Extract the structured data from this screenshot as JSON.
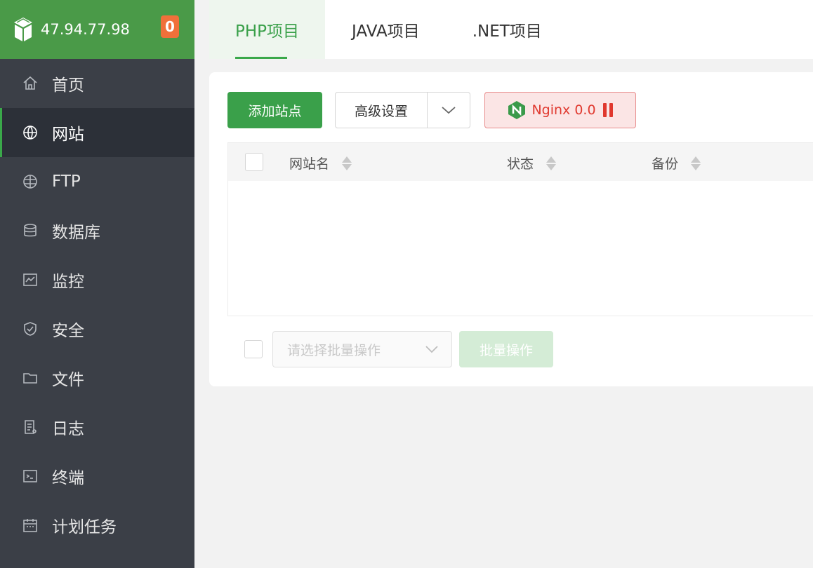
{
  "header": {
    "ip": "47.94.77.98",
    "badge": "0"
  },
  "sidebar": {
    "items": [
      {
        "label": "首页",
        "icon": "home-icon"
      },
      {
        "label": "网站",
        "icon": "globe-icon",
        "active": true
      },
      {
        "label": "FTP",
        "icon": "ftp-globe-icon"
      },
      {
        "label": "数据库",
        "icon": "database-icon"
      },
      {
        "label": "监控",
        "icon": "monitor-icon"
      },
      {
        "label": "安全",
        "icon": "shield-icon"
      },
      {
        "label": "文件",
        "icon": "folder-icon"
      },
      {
        "label": "日志",
        "icon": "log-icon"
      },
      {
        "label": "终端",
        "icon": "terminal-icon"
      },
      {
        "label": "计划任务",
        "icon": "calendar-icon"
      }
    ]
  },
  "tabs": [
    {
      "label": "PHP项目",
      "active": true
    },
    {
      "label": "JAVA项目"
    },
    {
      "label": ".NET项目"
    }
  ],
  "toolbar": {
    "add_site": "添加站点",
    "advanced": "高级设置",
    "nginx": "Nginx 0.0"
  },
  "table": {
    "columns": [
      "网站名",
      "状态",
      "备份"
    ],
    "rows": []
  },
  "footer": {
    "batch_placeholder": "请选择批量操作",
    "batch_button": "批量操作"
  },
  "colors": {
    "brand_green": "#3aa04a",
    "sidebar_bg": "#3b3f47",
    "badge_orange": "#f0703a",
    "nginx_red": "#e0382e"
  }
}
